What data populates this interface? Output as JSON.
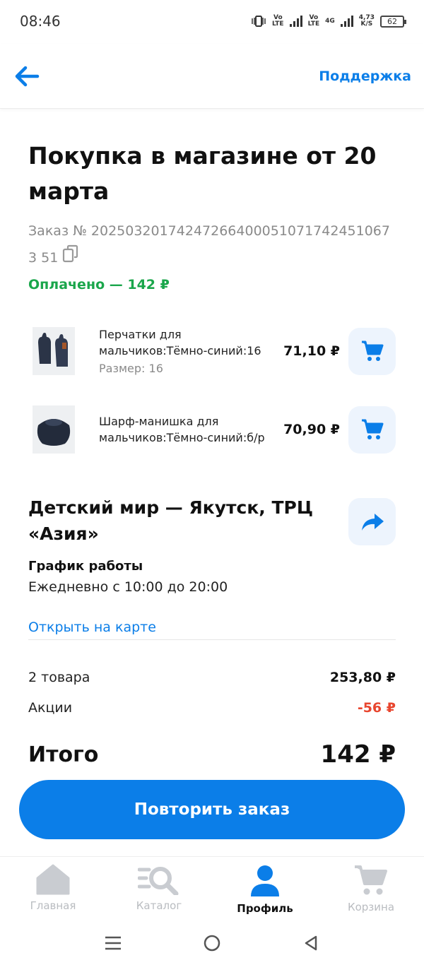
{
  "status_bar": {
    "time": "08:46",
    "net_speed": "4,73",
    "net_unit": "K/S",
    "battery": "62",
    "lte1": "Vo\nLTE",
    "lte2": "Vo\nLTE",
    "gen": "4G"
  },
  "header": {
    "back_icon": "arrow-left-icon",
    "support_label": "Поддержка"
  },
  "order": {
    "title": "Покупка в магазине от 20 марта",
    "number": "Заказ № 202503201742472664000510717424510673 51",
    "paid_status": "Оплачено — 142 ₽"
  },
  "products": [
    {
      "name": "Перчатки для мальчиков:Тёмно-синий:16",
      "size": "Размер: 16",
      "price": "71,10 ₽"
    },
    {
      "name": "Шарф-манишка для мальчиков:Тёмно-синий:б/р",
      "price": "70,90 ₽"
    }
  ],
  "store": {
    "name": "Детский мир — Якутск, ТРЦ «Азия»",
    "hours_title": "График работы",
    "hours": "Ежедневно с 10:00 до 20:00",
    "map_link": "Открыть на карте"
  },
  "summary": {
    "items_label": "2 товара",
    "items_value": "253,80 ₽",
    "promo_label": "Акции",
    "promo_value": "-56 ₽",
    "total_label": "Итого",
    "total_value": "142 ₽"
  },
  "repeat_button": "Повторить заказ",
  "bottom_nav": [
    {
      "label": "Главная",
      "icon": "home-icon",
      "active": false
    },
    {
      "label": "Каталог",
      "icon": "catalog-search-icon",
      "active": false
    },
    {
      "label": "Профиль",
      "icon": "profile-icon",
      "active": true
    },
    {
      "label": "Корзина",
      "icon": "cart-icon",
      "active": false
    }
  ],
  "colors": {
    "accent": "#0b7ee8",
    "paid": "#1aa64b",
    "discount": "#e8462f",
    "button_bg": "#edf4fd"
  }
}
